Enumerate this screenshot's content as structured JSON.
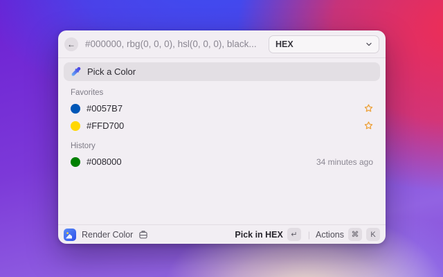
{
  "search": {
    "back_glyph": "←",
    "value": "#000000, rbg(0, 0, 0), hsl(0, 0, 0), black...",
    "dropdown_value": "HEX"
  },
  "command": {
    "label": "Pick a Color"
  },
  "favorites": {
    "title": "Favorites",
    "items": [
      {
        "label": "#0057B7",
        "color": "#0057B7"
      },
      {
        "label": "#FFD700",
        "color": "#FFD700"
      }
    ]
  },
  "history": {
    "title": "History",
    "items": [
      {
        "label": "#008000",
        "color": "#008000",
        "time": "34 minutes ago"
      }
    ]
  },
  "footer": {
    "app_name": "Render Color",
    "primary_action": "Pick in HEX",
    "primary_key": "↵",
    "divider": "|",
    "actions_label": "Actions",
    "key_cmd": "⌘",
    "key_k": "K"
  },
  "colors": {
    "star_orange": "#EDA23B",
    "selected_row_bg": "#E3DFE4",
    "window_bg": "#F2EEF3"
  }
}
